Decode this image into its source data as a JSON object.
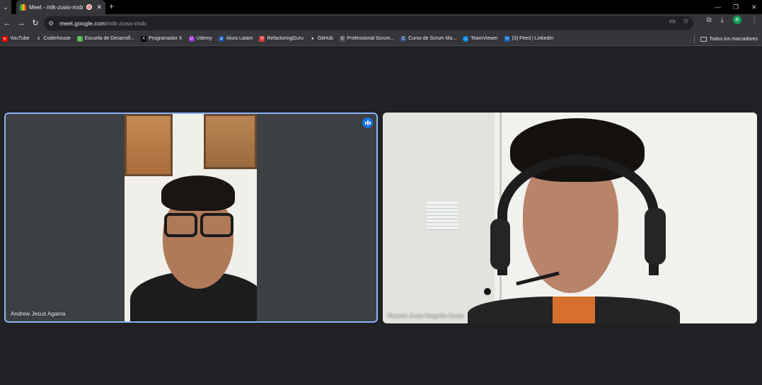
{
  "browser": {
    "tab": {
      "title": "Meet - mtk-zuwx-mxb"
    },
    "address": {
      "host": "meet.google.com",
      "path": "/mtk-zuwx-mxb"
    },
    "profile_initial": "R",
    "bookmarks": [
      {
        "label": "YouTube",
        "icon": "youtube-icon",
        "color": "#ff0000"
      },
      {
        "label": "Coderhouse",
        "icon": "coderhouse-icon",
        "color": "#333333"
      },
      {
        "label": "Escuela de Desarroll...",
        "icon": "diamond-icon",
        "color": "#4caf50"
      },
      {
        "label": "Programador X",
        "icon": "x-icon",
        "color": "#000000"
      },
      {
        "label": "Udemy",
        "icon": "udemy-icon",
        "color": "#a435f0"
      },
      {
        "label": "Alura Latam",
        "icon": "alura-icon",
        "color": "#1c5aa6"
      },
      {
        "label": "RefactoringGuru",
        "icon": "refactoring-icon",
        "color": "#e53935"
      },
      {
        "label": "GitHub",
        "icon": "github-icon",
        "color": "#333333"
      },
      {
        "label": "Professional Scrum...",
        "icon": "scrum-icon",
        "color": "#555555"
      },
      {
        "label": "Curso de Scrum Ma...",
        "icon": "curso-icon",
        "color": "#3b5998"
      },
      {
        "label": "TeamViewer",
        "icon": "teamviewer-icon",
        "color": "#0e8ee9"
      },
      {
        "label": "(3) Feed | LinkedIn",
        "icon": "linkedin-icon",
        "color": "#0a66c2"
      }
    ],
    "all_bookmarks": "Todos los marcadores"
  },
  "meeting": {
    "participants": [
      {
        "name": "Andrew Jesus Agama",
        "speaking": true
      },
      {
        "name": "Ricardo Jesus Maguiña Corzo",
        "speaking": false
      }
    ]
  },
  "colors": {
    "active_border": "#8ab4f8",
    "speaking_indicator": "#1a73e8"
  }
}
